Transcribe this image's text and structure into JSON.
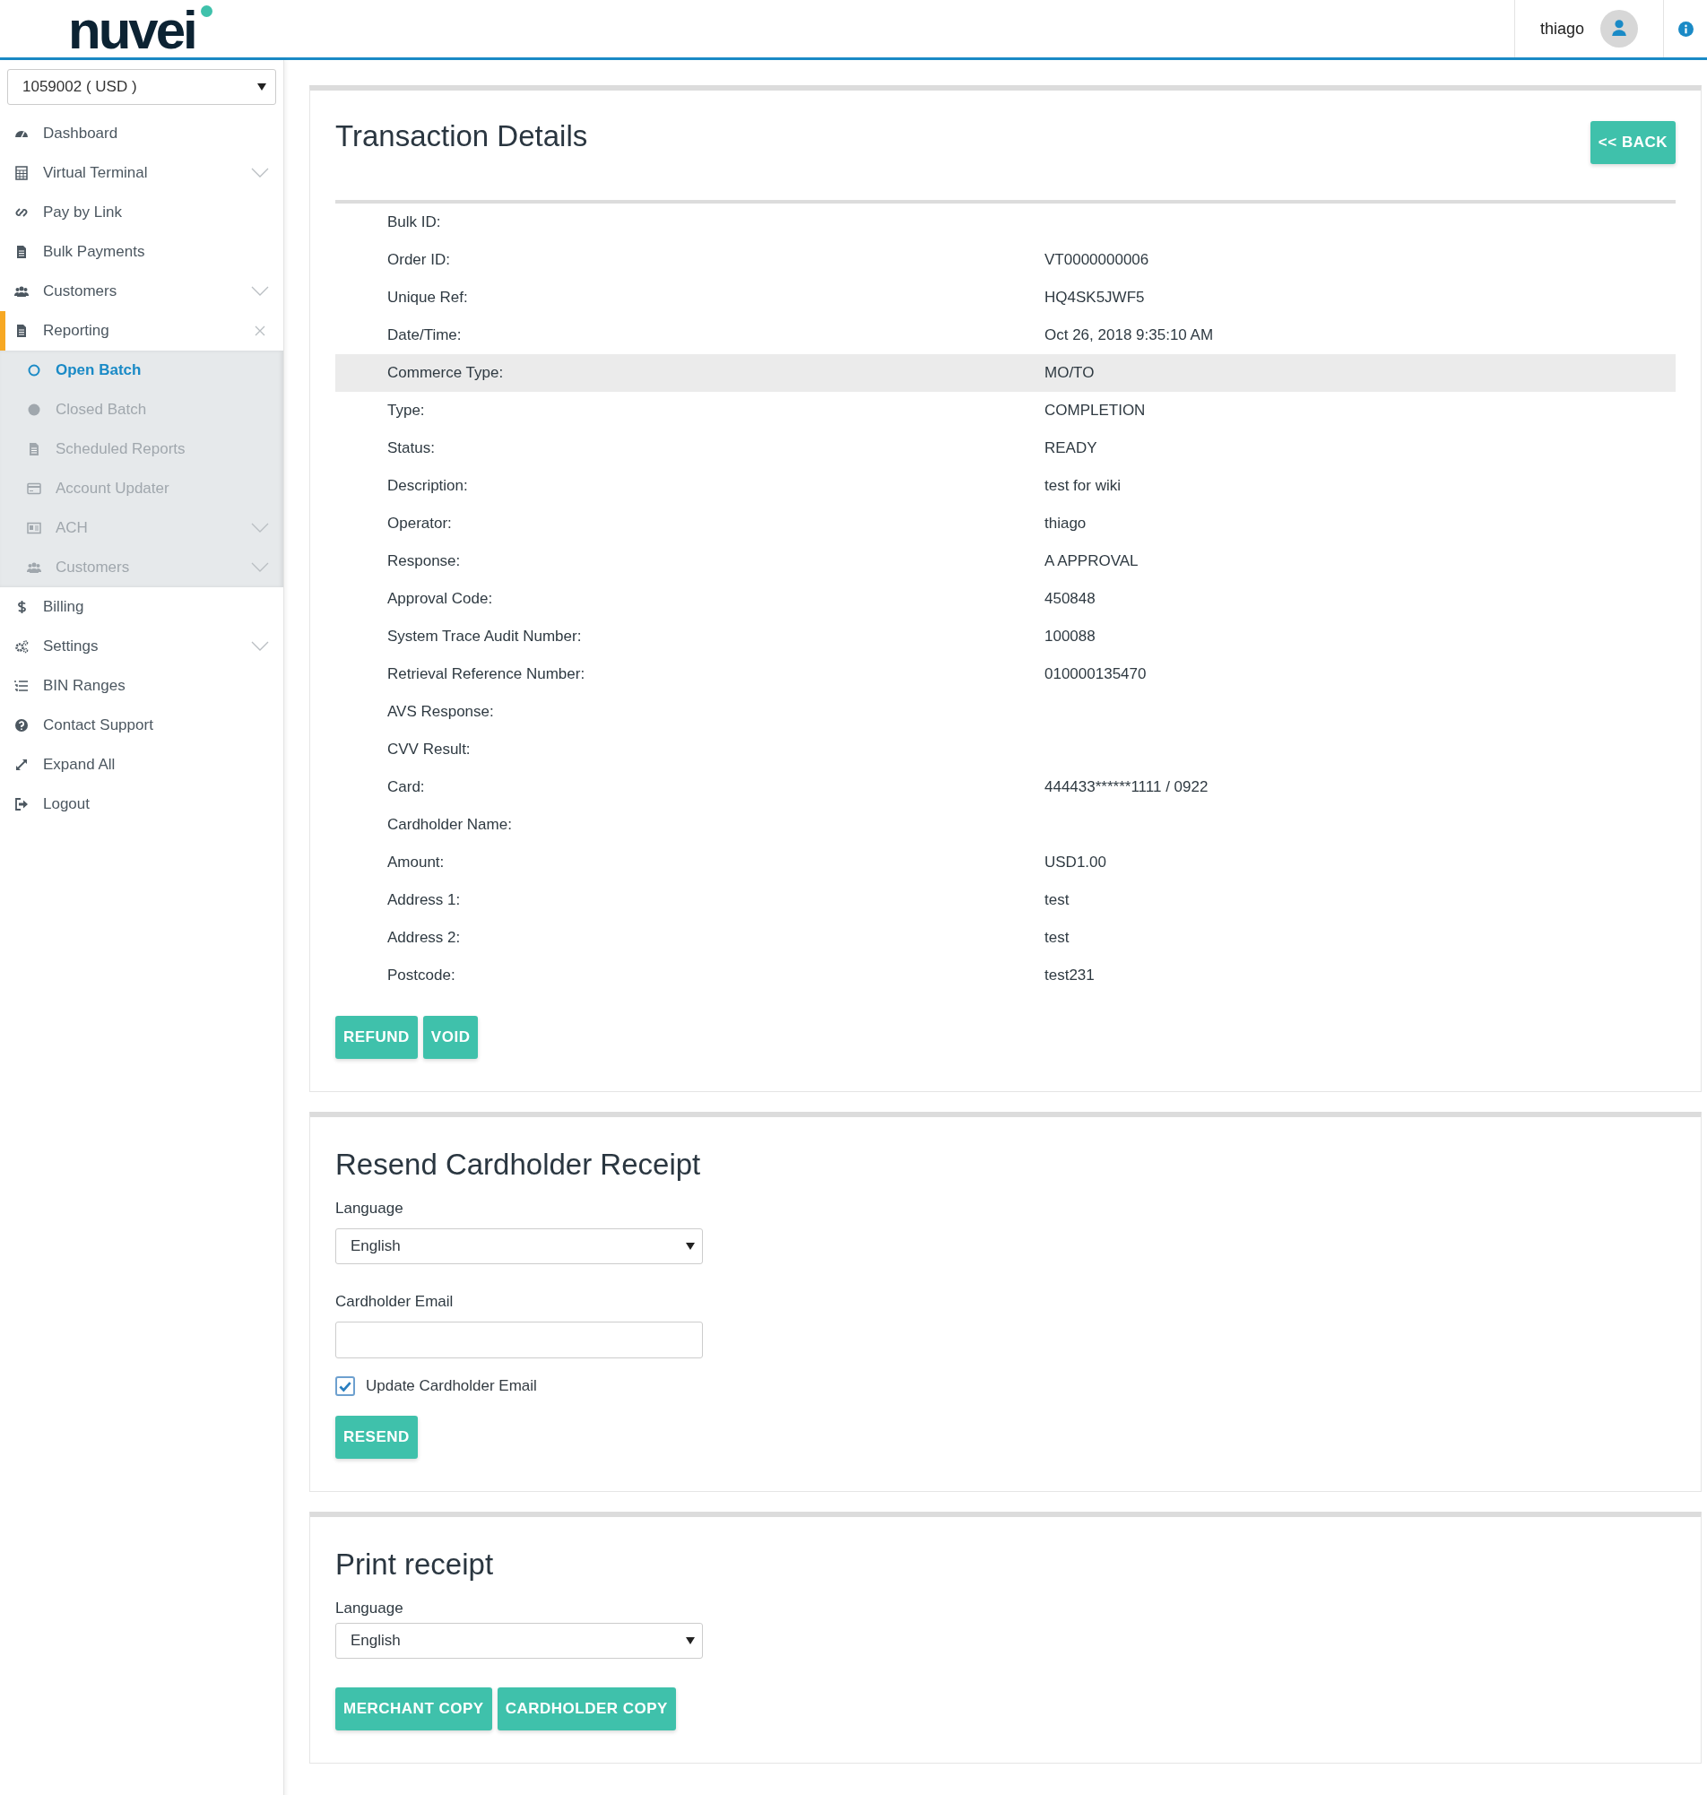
{
  "header": {
    "logo": "nuvei",
    "user": "thiago"
  },
  "sidebar": {
    "account": "1059002 ( USD )",
    "items": [
      {
        "label": "Dashboard",
        "kind": "link",
        "selected": false
      },
      {
        "label": "Virtual Terminal",
        "kind": "group",
        "expanded": false,
        "selected": false
      },
      {
        "label": "Pay by Link",
        "kind": "link",
        "selected": false
      },
      {
        "label": "Bulk Payments",
        "kind": "link",
        "selected": false
      },
      {
        "label": "Customers",
        "kind": "group",
        "expanded": false,
        "selected": false
      },
      {
        "label": "Reporting",
        "kind": "group",
        "expanded": true,
        "selected": true,
        "children": [
          {
            "label": "Open Batch",
            "kind": "link",
            "selected": true
          },
          {
            "label": "Closed Batch",
            "kind": "link",
            "selected": false
          },
          {
            "label": "Scheduled Reports",
            "kind": "link",
            "selected": false
          },
          {
            "label": "Account Updater",
            "kind": "link",
            "selected": false
          },
          {
            "label": "ACH",
            "kind": "group",
            "expanded": false,
            "selected": false
          },
          {
            "label": "Customers",
            "kind": "group",
            "expanded": false,
            "selected": false
          }
        ]
      },
      {
        "label": "Billing",
        "kind": "link",
        "selected": false
      },
      {
        "label": "Settings",
        "kind": "group",
        "expanded": false,
        "selected": false
      },
      {
        "label": "BIN Ranges",
        "kind": "link",
        "selected": false
      },
      {
        "label": "Contact Support",
        "kind": "link",
        "selected": false
      },
      {
        "label": "Expand All",
        "kind": "link",
        "selected": false
      },
      {
        "label": "Logout",
        "kind": "link",
        "selected": false
      }
    ]
  },
  "details": {
    "title": "Transaction Details",
    "back": "<< BACK",
    "rows": [
      {
        "label": "Bulk ID:",
        "selected": false
      },
      {
        "label": "Order ID:",
        "value": "VT0000000006",
        "selected": false
      },
      {
        "label": "Unique Ref:",
        "value": "HQ4SK5JWF5",
        "selected": false
      },
      {
        "label": "Date/Time:",
        "value": "Oct 26, 2018 9:35:10 AM",
        "selected": false
      },
      {
        "label": "Commerce Type:",
        "value": "MO/TO",
        "selected": true
      },
      {
        "label": "Type:",
        "value": "COMPLETION",
        "selected": false
      },
      {
        "label": "Status:",
        "value": "READY",
        "selected": false
      },
      {
        "label": "Description:",
        "value": "test for wiki",
        "selected": false
      },
      {
        "label": "Operator:",
        "value": "thiago",
        "selected": false
      },
      {
        "label": "Response:",
        "value": "A APPROVAL",
        "selected": false
      },
      {
        "label": "Approval Code:",
        "value": "450848",
        "selected": false
      },
      {
        "label": "System Trace Audit Number:",
        "value": "100088",
        "selected": false
      },
      {
        "label": "Retrieval Reference Number:",
        "value": "010000135470",
        "selected": false
      },
      {
        "label": "AVS Response:",
        "selected": false
      },
      {
        "label": "CVV Result:",
        "selected": false
      },
      {
        "label": "Card:",
        "value": "444433******1111 / 0922",
        "selected": false
      },
      {
        "label": "Cardholder Name:",
        "selected": false
      },
      {
        "label": "Amount:",
        "value": "USD1.00",
        "selected": false
      },
      {
        "label": "Address 1:",
        "value": "test",
        "selected": false
      },
      {
        "label": "Address 2:",
        "value": "test",
        "selected": false
      },
      {
        "label": "Postcode:",
        "value": "test231",
        "selected": false
      }
    ],
    "actions": [
      "REFUND",
      "VOID"
    ]
  },
  "resend": {
    "title": "Resend Cardholder Receipt",
    "language_label": "Language",
    "language": "English",
    "email_label": "Cardholder Email",
    "update_email": {
      "label": "Update Cardholder Email",
      "checked": true
    },
    "button": "RESEND"
  },
  "print": {
    "title": "Print receipt",
    "language_label": "Language",
    "language": "English",
    "buttons": [
      "MERCHANT COPY",
      "CARDHOLDER COPY"
    ]
  }
}
